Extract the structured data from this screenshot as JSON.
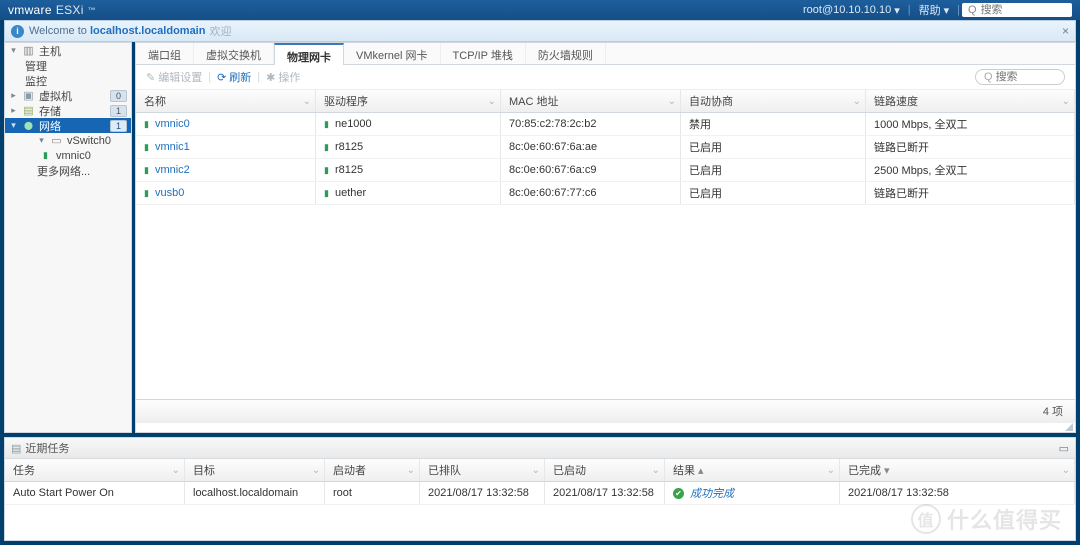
{
  "topbar": {
    "brand_vm": "vmware",
    "brand_prod": "ESXi",
    "user": "root@10.10.10.10",
    "help": "帮助",
    "search_placeholder": "搜索"
  },
  "breadcrumb": {
    "prefix": "Welcome to",
    "host": "localhost.localdomain",
    "suffix": "欢迎"
  },
  "nav": {
    "host": "主机",
    "manage": "管理",
    "monitor": "监控",
    "vms": "虚拟机",
    "vms_badge": "0",
    "ds": "存储",
    "ds_badge": "1",
    "net": "网络",
    "net_badge": "1",
    "vswitch": "vSwitch0",
    "pnic": "vmnic0",
    "more": "更多网络..."
  },
  "tabs": {
    "t1": "端口组",
    "t2": "虚拟交换机",
    "t3": "物理网卡",
    "t4": "VMkernel 网卡",
    "t5": "TCP/IP 堆栈",
    "t6": "防火墙规则"
  },
  "toolbar": {
    "edit": "编辑设置",
    "refresh": "刷新",
    "action": "操作",
    "search_placeholder": "搜索"
  },
  "grid": {
    "headers": {
      "name": "名称",
      "driver": "驱动程序",
      "mac": "MAC 地址",
      "auto": "自动协商",
      "speed": "链路速度"
    },
    "rows": [
      {
        "name": "vmnic0",
        "driver": "ne1000",
        "mac": "70:85:c2:78:2c:b2",
        "auto": "禁用",
        "speed": "1000 Mbps, 全双工"
      },
      {
        "name": "vmnic1",
        "driver": "r8125",
        "mac": "8c:0e:60:67:6a:ae",
        "auto": "已启用",
        "speed": "链路已断开"
      },
      {
        "name": "vmnic2",
        "driver": "r8125",
        "mac": "8c:0e:60:67:6a:c9",
        "auto": "已启用",
        "speed": "2500 Mbps, 全双工"
      },
      {
        "name": "vusb0",
        "driver": "uether",
        "mac": "8c:0e:60:67:77:c6",
        "auto": "已启用",
        "speed": "链路已断开"
      }
    ],
    "footer": "4 项"
  },
  "tasks": {
    "title": "近期任务",
    "headers": {
      "task": "任务",
      "target": "目标",
      "initiator": "启动者",
      "queued": "已排队",
      "started": "已启动",
      "result": "结果",
      "completed": "已完成"
    },
    "rows": [
      {
        "task": "Auto Start Power On",
        "target": "localhost.localdomain",
        "initiator": "root",
        "queued": "2021/08/17 13:32:58",
        "started": "2021/08/17 13:32:58",
        "result": "成功完成",
        "completed": "2021/08/17 13:32:58"
      }
    ]
  },
  "watermark": "什么值得买"
}
